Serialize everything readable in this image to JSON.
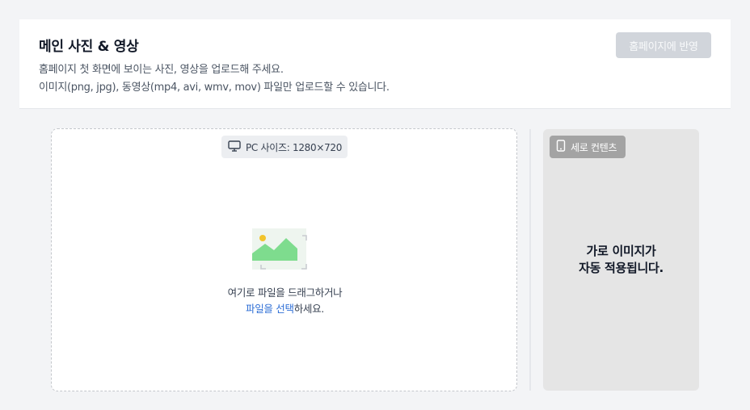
{
  "header": {
    "title": "메인 사진 & 영상",
    "description_line1": "홈페이지 첫 화면에 보이는 사진, 영상을 업로드해 주세요.",
    "description_line2": "이미지(png, jpg), 동영상(mp4, avi, wmv, mov) 파일만 업로드할 수 있습니다.",
    "apply_button": "홈페이지에 반영"
  },
  "upload": {
    "size_label": "PC 사이즈: 1280×720",
    "size_icon": "monitor-icon",
    "placeholder_icon": "image-placeholder-icon",
    "drag_text": "여기로 파일을 드래그하거나",
    "select_link": "파일을 선택",
    "select_suffix": "하세요."
  },
  "vertical": {
    "badge_label": "세로 컨텐츠",
    "badge_icon": "smartphone-icon",
    "message_line1": "가로 이미지가",
    "message_line2": "자동 적용됩니다."
  },
  "colors": {
    "link": "#2f6fd6",
    "disabled_button": "#d1d5db",
    "image_green": "#7edc8e",
    "image_sun": "#f2c42c"
  }
}
